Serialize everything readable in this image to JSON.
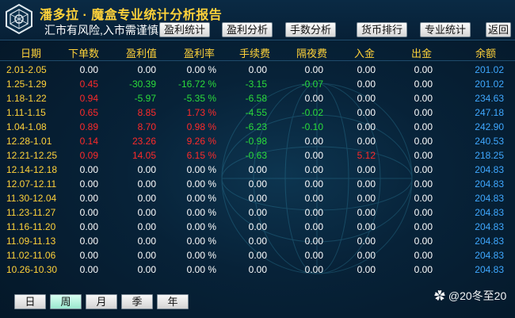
{
  "app": {
    "title": "潘多拉 · 魔盒专业统计分析报告",
    "slogan": "汇市有风险,入市需谨慎!"
  },
  "nav": [
    {
      "label": "盈利统计"
    },
    {
      "label": "盈利分析"
    },
    {
      "label": "手数分析"
    },
    {
      "label": "货币排行"
    },
    {
      "label": "专业统计"
    },
    {
      "label": "返回"
    }
  ],
  "table": {
    "columns": [
      "日期",
      "下单数",
      "盈利值",
      "盈利率",
      "手续费",
      "隔夜费",
      "入金",
      "出金",
      "余额"
    ],
    "rows": [
      {
        "date": "2.01-2.05",
        "orders": "0.00",
        "profit": "0.00",
        "rate": "0.00 %",
        "fee": "0.00",
        "swap": "0.00",
        "deposit": "0.00",
        "withdraw": "0.00",
        "balance": "201.02"
      },
      {
        "date": "1.25-1.29",
        "orders": "0.45",
        "profit": "-30.39",
        "rate": "-16.72 %",
        "fee": "-3.15",
        "swap": "-0.07",
        "deposit": "0.00",
        "withdraw": "0.00",
        "balance": "201.02"
      },
      {
        "date": "1.18-1.22",
        "orders": "0.94",
        "profit": "-5.97",
        "rate": "-5.35 %",
        "fee": "-6.58",
        "swap": "0.00",
        "deposit": "0.00",
        "withdraw": "0.00",
        "balance": "234.63"
      },
      {
        "date": "1.11-1.15",
        "orders": "0.65",
        "profit": "8.85",
        "rate": "1.73 %",
        "fee": "-4.55",
        "swap": "-0.02",
        "deposit": "0.00",
        "withdraw": "0.00",
        "balance": "247.18"
      },
      {
        "date": "1.04-1.08",
        "orders": "0.89",
        "profit": "8.70",
        "rate": "0.98 %",
        "fee": "-6.23",
        "swap": "-0.10",
        "deposit": "0.00",
        "withdraw": "0.00",
        "balance": "242.90"
      },
      {
        "date": "12.28-1.01",
        "orders": "0.14",
        "profit": "23.26",
        "rate": "9.26 %",
        "fee": "-0.98",
        "swap": "0.00",
        "deposit": "0.00",
        "withdraw": "0.00",
        "balance": "240.53"
      },
      {
        "date": "12.21-12.25",
        "orders": "0.09",
        "profit": "14.05",
        "rate": "6.15 %",
        "fee": "-0.63",
        "swap": "0.00",
        "deposit": "5.12",
        "withdraw": "0.00",
        "balance": "218.25"
      },
      {
        "date": "12.14-12.18",
        "orders": "0.00",
        "profit": "0.00",
        "rate": "0.00 %",
        "fee": "0.00",
        "swap": "0.00",
        "deposit": "0.00",
        "withdraw": "0.00",
        "balance": "204.83"
      },
      {
        "date": "12.07-12.11",
        "orders": "0.00",
        "profit": "0.00",
        "rate": "0.00 %",
        "fee": "0.00",
        "swap": "0.00",
        "deposit": "0.00",
        "withdraw": "0.00",
        "balance": "204.83"
      },
      {
        "date": "11.30-12.04",
        "orders": "0.00",
        "profit": "0.00",
        "rate": "0.00 %",
        "fee": "0.00",
        "swap": "0.00",
        "deposit": "0.00",
        "withdraw": "0.00",
        "balance": "204.83"
      },
      {
        "date": "11.23-11.27",
        "orders": "0.00",
        "profit": "0.00",
        "rate": "0.00 %",
        "fee": "0.00",
        "swap": "0.00",
        "deposit": "0.00",
        "withdraw": "0.00",
        "balance": "204.83"
      },
      {
        "date": "11.16-11.20",
        "orders": "0.00",
        "profit": "0.00",
        "rate": "0.00 %",
        "fee": "0.00",
        "swap": "0.00",
        "deposit": "0.00",
        "withdraw": "0.00",
        "balance": "204.83"
      },
      {
        "date": "11.09-11.13",
        "orders": "0.00",
        "profit": "0.00",
        "rate": "0.00 %",
        "fee": "0.00",
        "swap": "0.00",
        "deposit": "0.00",
        "withdraw": "0.00",
        "balance": "204.83"
      },
      {
        "date": "11.02-11.06",
        "orders": "0.00",
        "profit": "0.00",
        "rate": "0.00 %",
        "fee": "0.00",
        "swap": "0.00",
        "deposit": "0.00",
        "withdraw": "0.00",
        "balance": "204.83"
      },
      {
        "date": "10.26-10.30",
        "orders": "0.00",
        "profit": "0.00",
        "rate": "0.00 %",
        "fee": "0.00",
        "swap": "0.00",
        "deposit": "0.00",
        "withdraw": "0.00",
        "balance": "204.83"
      }
    ]
  },
  "period_tabs": [
    {
      "label": "日",
      "active": false
    },
    {
      "label": "周",
      "active": true
    },
    {
      "label": "月",
      "active": false
    },
    {
      "label": "季",
      "active": false
    },
    {
      "label": "年",
      "active": false
    }
  ],
  "watermark": "@20冬至20",
  "colors": {
    "header_text": "#ffd23a",
    "loss": "#ff2a2a",
    "gain": "#2bdc3a",
    "balance": "#3fa8ff",
    "background": "#072238"
  },
  "icons": {
    "logo": "hexagon-logo-icon",
    "watermark": "weibo-icon"
  }
}
